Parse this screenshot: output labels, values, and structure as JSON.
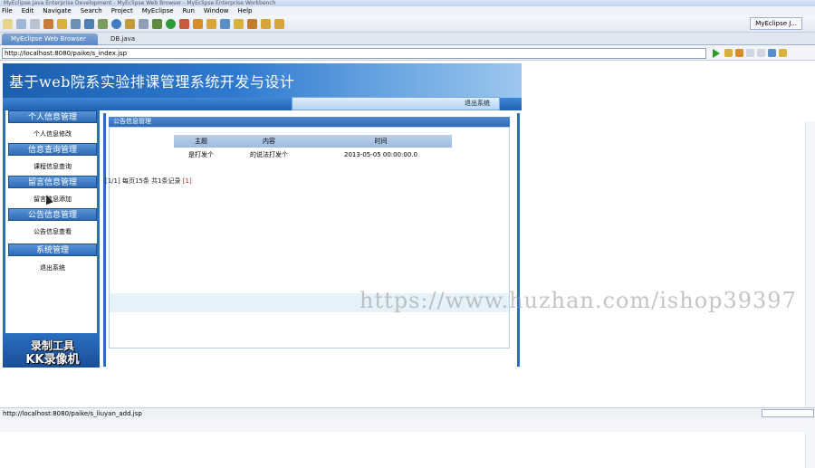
{
  "window": {
    "title": "MyEclipse Java Enterprise Development - MyEclipse Web Browser - MyEclipse Enterprise Workbench"
  },
  "menu": [
    "File",
    "Edit",
    "Navigate",
    "Search",
    "Project",
    "MyEclipse",
    "Run",
    "Window",
    "Help"
  ],
  "perspective": "MyEclipse J...",
  "tabs": [
    {
      "label": "MyEclipse Web Browser",
      "active": true
    },
    {
      "label": "DB.java",
      "active": false
    }
  ],
  "address": {
    "url": "http://localhost:8080/paike/s_index.jsp"
  },
  "page": {
    "title": "基于web院系实验排课管理系统开发与设计",
    "logout": "退出系统",
    "sections": [
      {
        "label": "个人信息管理",
        "item": "个人信息修改"
      },
      {
        "label": "信息查询管理",
        "item": "课程信息查询"
      },
      {
        "label": "留言信息管理",
        "item": "留言信息添加"
      },
      {
        "label": "公告信息管理",
        "item": "公告信息查看"
      },
      {
        "label": "系统管理",
        "item": "退出系统"
      }
    ],
    "panel_title": "公告信息管理",
    "table": {
      "headers": [
        "主题",
        "内容",
        "时间"
      ],
      "rows": [
        [
          "是打发个",
          "的说法打发个",
          "2013-05-05 00:00:00.0"
        ]
      ]
    },
    "pager": {
      "prefix": "[1/1] 每页15条 共1条记录",
      "page_link": "[1]"
    }
  },
  "watermark": "https://www.huzhan.com/ishop39397",
  "recorder_watermark": {
    "line1": "录制工具",
    "line2": "KK录像机"
  },
  "status": {
    "url": "http://localhost:8080/paike/s_liuyan_add.jsp"
  },
  "colors": {
    "accent": "#2a6fc1",
    "header_dark": "#1c5fae",
    "pager_red": "#b02020"
  }
}
